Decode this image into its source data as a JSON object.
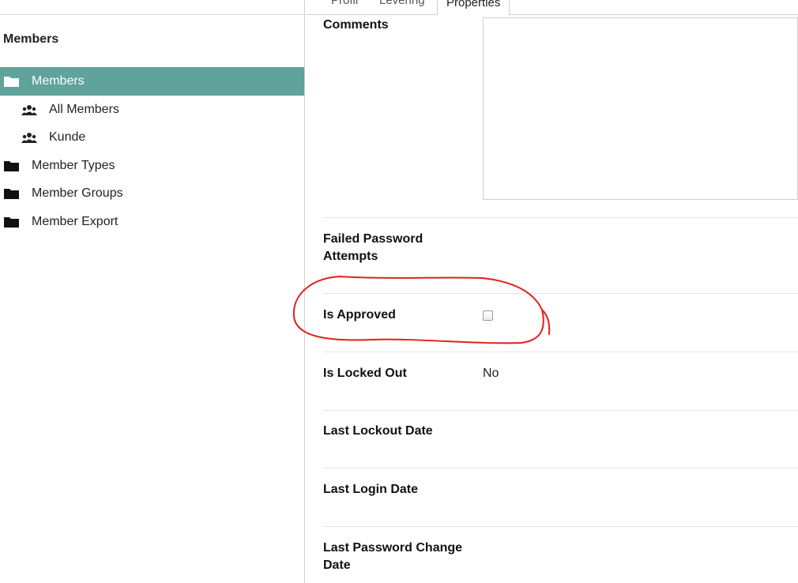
{
  "tabs": [
    {
      "label": "Profil"
    },
    {
      "label": "Levering"
    },
    {
      "label": "Properties",
      "active": true
    }
  ],
  "sidebar": {
    "title": "Members",
    "items": [
      {
        "label": "Members",
        "icon": "folder-open-icon",
        "active": true
      },
      {
        "label": "All Members",
        "icon": "members-icon"
      },
      {
        "label": "Kunde",
        "icon": "members-icon"
      },
      {
        "label": "Member Types",
        "icon": "folder-icon"
      },
      {
        "label": "Member Groups",
        "icon": "folder-icon"
      },
      {
        "label": "Member Export",
        "icon": "folder-icon"
      }
    ]
  },
  "properties": {
    "comments_label": "Comments",
    "comments_value": "",
    "failed_password_label_1": "Failed Password",
    "failed_password_label_2": "Attempts",
    "is_approved_label": "Is Approved",
    "is_approved_checked": false,
    "is_locked_out_label": "Is Locked Out",
    "is_locked_out_value": "No",
    "last_lockout_label": "Last Lockout Date",
    "last_login_label": "Last Login Date",
    "last_password_change_label_1": "Last Password Change",
    "last_password_change_label_2": "Date"
  },
  "colors": {
    "active_item_bg": "#5fa39a",
    "annotation": "#e0201b"
  }
}
